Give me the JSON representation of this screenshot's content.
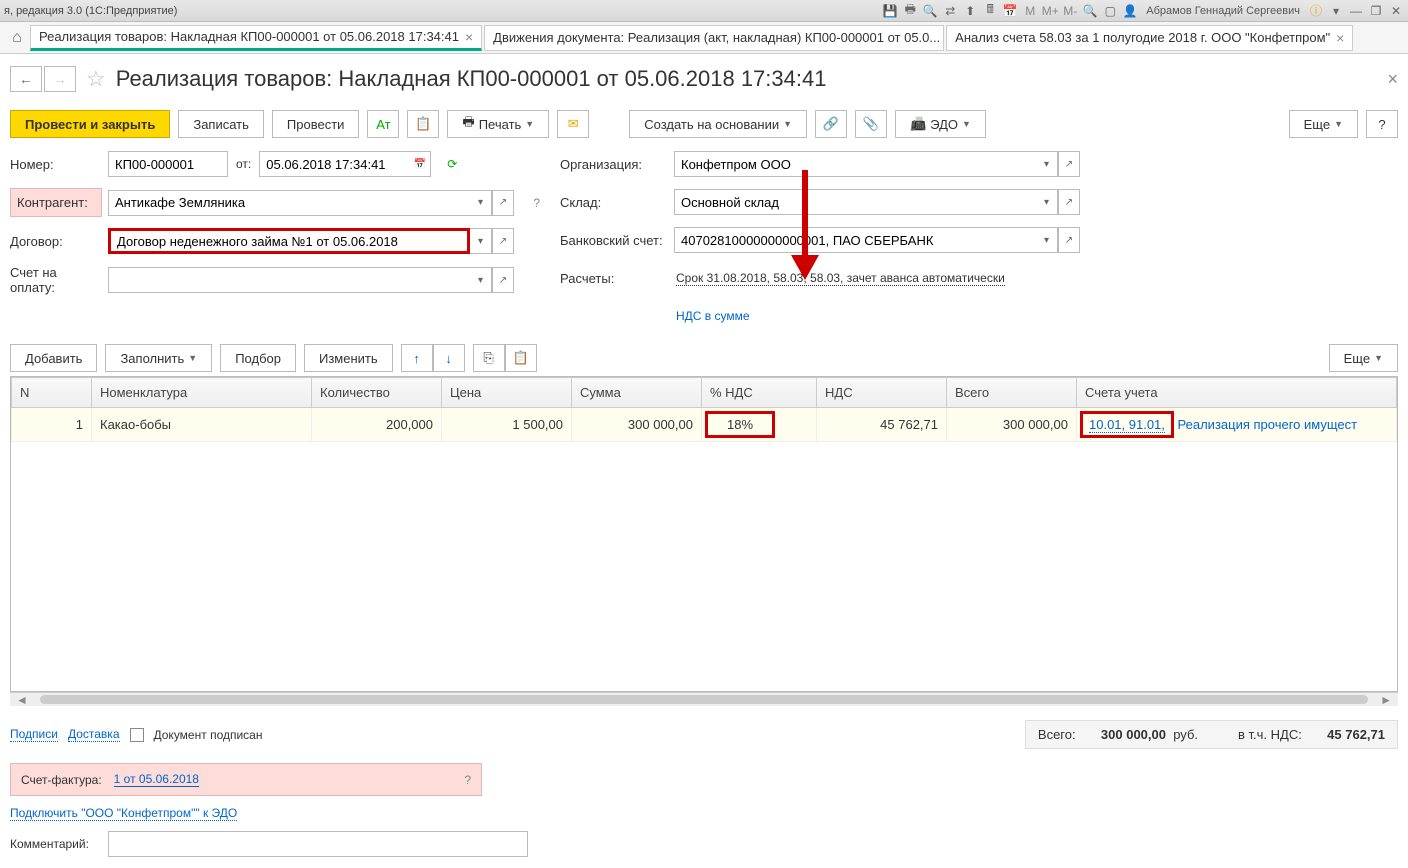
{
  "titlebar": {
    "left": "я, редакция 3.0  (1С:Предприятие)",
    "user": "Абрамов Геннадий Сергеевич",
    "icons_m": [
      "M",
      "M+",
      "M-"
    ]
  },
  "tabs": {
    "t1": "Реализация товаров: Накладная КП00-000001 от 05.06.2018 17:34:41",
    "t2": "Движения документа: Реализация (акт, накладная) КП00-000001 от 05.0...",
    "t3": "Анализ счета 58.03 за 1 полугодие 2018 г. ООО \"Конфетпром\""
  },
  "page": {
    "title": "Реализация товаров: Накладная КП00-000001 от 05.06.2018 17:34:41"
  },
  "toolbar": {
    "post_close": "Провести и закрыть",
    "save": "Записать",
    "post": "Провести",
    "print": "Печать",
    "create_based": "Создать на основании",
    "edo": "ЭДО",
    "more": "Еще"
  },
  "form": {
    "number_lbl": "Номер:",
    "number": "КП00-000001",
    "from_lbl": "от:",
    "date": "05.06.2018 17:34:41",
    "counterparty_lbl": "Контрагент:",
    "counterparty": "Антикафе Земляника",
    "contract_lbl": "Договор:",
    "contract": "Договор неденежного займа №1 от 05.06.2018",
    "invoice_pay_lbl": "Счет на оплату:",
    "org_lbl": "Организация:",
    "org": "Конфетпром ООО",
    "warehouse_lbl": "Склад:",
    "warehouse": "Основной склад",
    "bank_lbl": "Банковский счет:",
    "bank": "40702810000000000001, ПАО СБЕРБАНК",
    "calc_lbl": "Расчеты:",
    "calc_link": "Срок 31.08.2018, 58.03, 58.03, зачет аванса автоматически",
    "nds_link": "НДС в сумме"
  },
  "table_toolbar": {
    "add": "Добавить",
    "fill": "Заполнить",
    "select": "Подбор",
    "change": "Изменить",
    "more": "Еще"
  },
  "table": {
    "headers": {
      "n": "N",
      "nomen": "Номенклатура",
      "qty": "Количество",
      "price": "Цена",
      "sum": "Сумма",
      "pct_nds": "% НДС",
      "nds": "НДС",
      "total": "Всего",
      "accounts": "Счета учета"
    },
    "row1": {
      "n": "1",
      "nomen": "Какао-бобы",
      "qty": "200,000",
      "price": "1 500,00",
      "sum": "300 000,00",
      "pct_nds": "18%",
      "nds": "45 762,71",
      "total": "300 000,00",
      "acc": "10.01, 91.01,",
      "acc_text": "Реализация прочего имущест"
    }
  },
  "footer": {
    "signatures": "Подписи",
    "delivery": "Доставка",
    "doc_signed": "Документ подписан",
    "total_lbl": "Всего:",
    "total": "300 000,00",
    "rub": "руб.",
    "nds_lbl": "в т.ч. НДС:",
    "nds": "45 762,71",
    "invoice_lbl": "Счет-фактура:",
    "invoice_link": "1 от 05.06.2018",
    "connect_edo": "Подключить \"ООО \"Конфетпром\"\" к ЭДО",
    "comment_lbl": "Комментарий:"
  }
}
